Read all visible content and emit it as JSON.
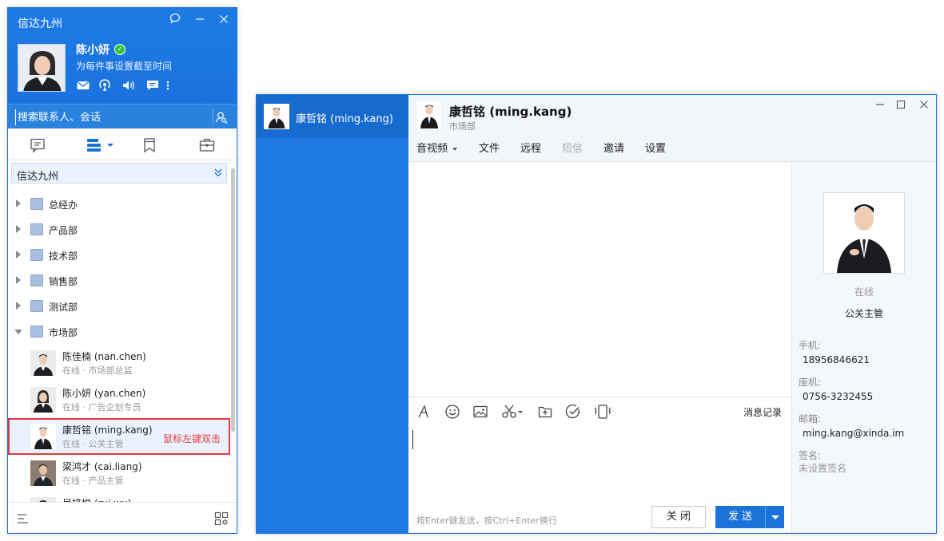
{
  "main_window": {
    "title": "信达九州",
    "controls": [
      "chat-bubble-icon",
      "minimize-icon",
      "close-icon"
    ],
    "user": {
      "name": "陈小妍",
      "status": "online",
      "signature": "为每件事设置截至时间"
    },
    "header_tools": [
      "mail-icon",
      "broadcast-icon",
      "speaker-icon",
      "message-icon",
      "more-icon"
    ],
    "search": {
      "placeholder": "搜索联系人、会话"
    },
    "nav_tabs": [
      "chat-tab-icon",
      "org-tab-icon",
      "bookmark-tab-icon",
      "workbench-tab-icon"
    ],
    "org_selector": {
      "label": "信达九州"
    },
    "departments": [
      {
        "name": "总经办",
        "expanded": false
      },
      {
        "name": "产品部",
        "expanded": false
      },
      {
        "name": "技术部",
        "expanded": false
      },
      {
        "name": "销售部",
        "expanded": false
      },
      {
        "name": "测试部",
        "expanded": false
      },
      {
        "name": "市场部",
        "expanded": true
      }
    ],
    "contacts": [
      {
        "name": "陈佳楠 (nan.chen)",
        "status": "在线 · 市场部总监"
      },
      {
        "name": "陈小妍 (yan.chen)",
        "status": "在线 · 广告企划专员"
      },
      {
        "name": "康哲铭 (ming.kang)",
        "status": "在线 · 公关主管",
        "selected": true
      },
      {
        "name": "梁鸿才 (cai.liang)",
        "status": "在线 · 产品主管"
      },
      {
        "name": "吴梓悦 (rui.wu)",
        "status": ""
      }
    ],
    "annotation": "鼠标左键双击"
  },
  "chat_window": {
    "session": {
      "name": "康哲铭 (ming.kang)"
    },
    "contact": {
      "name": "康哲铭 (ming.kang)",
      "department": "市场部"
    },
    "menu": [
      {
        "label": "音视频",
        "dropdown": true,
        "enabled": true
      },
      {
        "label": "文件",
        "enabled": true
      },
      {
        "label": "远程",
        "enabled": true
      },
      {
        "label": "短信",
        "enabled": false
      },
      {
        "label": "邀请",
        "enabled": true
      },
      {
        "label": "设置",
        "enabled": true
      }
    ],
    "input_tools": [
      "font-icon",
      "emoji-icon",
      "image-icon",
      "screenshot-icon",
      "upload-file-icon",
      "check-icon",
      "shake-icon"
    ],
    "history_label": "消息记录",
    "send_hint": "按Enter键发送，按Ctrl+Enter换行",
    "close_label": "关 闭",
    "send_label": "发 送",
    "profile": {
      "status": "在线",
      "title": "公关主管",
      "phone_label": "手机:",
      "phone": "18956846621",
      "landline_label": "座机:",
      "landline": "0756-3232455",
      "email_label": "邮箱:",
      "email": "ming.kang@xinda.im",
      "signature_label": "签名:",
      "signature": "未设置签名"
    }
  },
  "colors": {
    "brand_blue": "#1a73d9",
    "highlight_red": "#e5383b",
    "online_green": "#36c13b"
  }
}
